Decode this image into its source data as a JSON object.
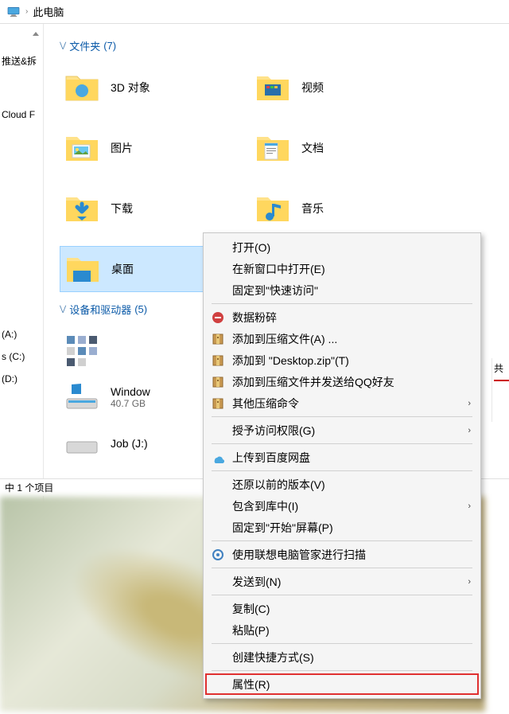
{
  "breadcrumb": {
    "label": "此电脑"
  },
  "sidebar": {
    "items": [
      {
        "label": "推送&拆"
      },
      {
        "label": "Cloud F"
      },
      {
        "label": ""
      },
      {
        "label": "(A:)"
      },
      {
        "label": "s (C:)"
      },
      {
        "label": "(D:)"
      }
    ]
  },
  "groups": {
    "folders": {
      "label": "文件夹",
      "count": "(7)"
    },
    "devices": {
      "label": "设备和驱动器",
      "count": "(5)"
    }
  },
  "folders": [
    {
      "label": "3D 对象"
    },
    {
      "label": "视频"
    },
    {
      "label": "图片"
    },
    {
      "label": "文档"
    },
    {
      "label": "下载"
    },
    {
      "label": "音乐"
    },
    {
      "label": "桌面"
    }
  ],
  "drives": [
    {
      "label": " "
    },
    {
      "label": "Window",
      "sub": "40.7 GB"
    },
    {
      "label": "Job (J:)"
    }
  ],
  "side_panel": {
    "label": "共"
  },
  "status": {
    "text": "中 1 个项目"
  },
  "context_menu": {
    "items": [
      {
        "label": "打开(O)"
      },
      {
        "label": "在新窗口中打开(E)"
      },
      {
        "label": "固定到\"快速访问\""
      },
      {
        "sep": true
      },
      {
        "label": "数据粉碎",
        "icon": "red-circle"
      },
      {
        "label": "添加到压缩文件(A) ...",
        "icon": "archive"
      },
      {
        "label": "添加到 \"Desktop.zip\"(T)",
        "icon": "archive"
      },
      {
        "label": "添加到压缩文件并发送给QQ好友",
        "icon": "archive"
      },
      {
        "label": "其他压缩命令",
        "icon": "archive",
        "arrow": true
      },
      {
        "sep": true
      },
      {
        "label": "授予访问权限(G)",
        "arrow": true
      },
      {
        "sep": true
      },
      {
        "label": "上传到百度网盘",
        "icon": "cloud"
      },
      {
        "sep": true
      },
      {
        "label": "还原以前的版本(V)"
      },
      {
        "label": "包含到库中(I)",
        "arrow": true
      },
      {
        "label": "固定到\"开始\"屏幕(P)"
      },
      {
        "sep": true
      },
      {
        "label": "使用联想电脑管家进行扫描",
        "icon": "scan"
      },
      {
        "sep": true
      },
      {
        "label": "发送到(N)",
        "arrow": true
      },
      {
        "sep": true
      },
      {
        "label": "复制(C)"
      },
      {
        "label": "粘贴(P)"
      },
      {
        "sep": true
      },
      {
        "label": "创建快捷方式(S)"
      },
      {
        "sep": true
      },
      {
        "label": "属性(R)",
        "highlight": true
      }
    ]
  }
}
